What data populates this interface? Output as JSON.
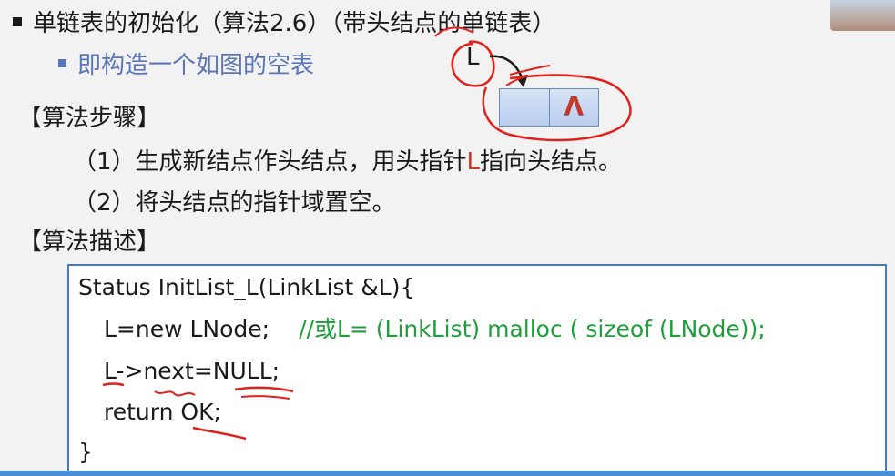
{
  "title": "单链表的初始化（算法2.6）（带头结点的单链表）",
  "subtitle": "即构造一个如图的空表",
  "steps_heading": "【算法步骤】",
  "steps": [
    {
      "prefix": "（1）生成新结点作头结点，用头指针",
      "highlight": "L",
      "suffix": "指向头结点。"
    },
    {
      "prefix": "（2）将头结点的指针域置空。",
      "highlight": "",
      "suffix": ""
    }
  ],
  "desc_heading": "【算法描述】",
  "code": {
    "line1": "Status InitList_L(LinkList &L){",
    "line2_code": "L=new LNode;",
    "line2_comment": "//或L= (LinkList) malloc ( sizeof (LNode));",
    "line3": "L->next=NULL;",
    "line4": "return OK;",
    "line5": "}"
  },
  "diagram": {
    "pointer_label": "L",
    "null_symbol": "Λ"
  },
  "colors": {
    "accent_blue": "#5b76b8",
    "annotation_red": "#e0201a",
    "comment_green": "#1f9e3c"
  }
}
